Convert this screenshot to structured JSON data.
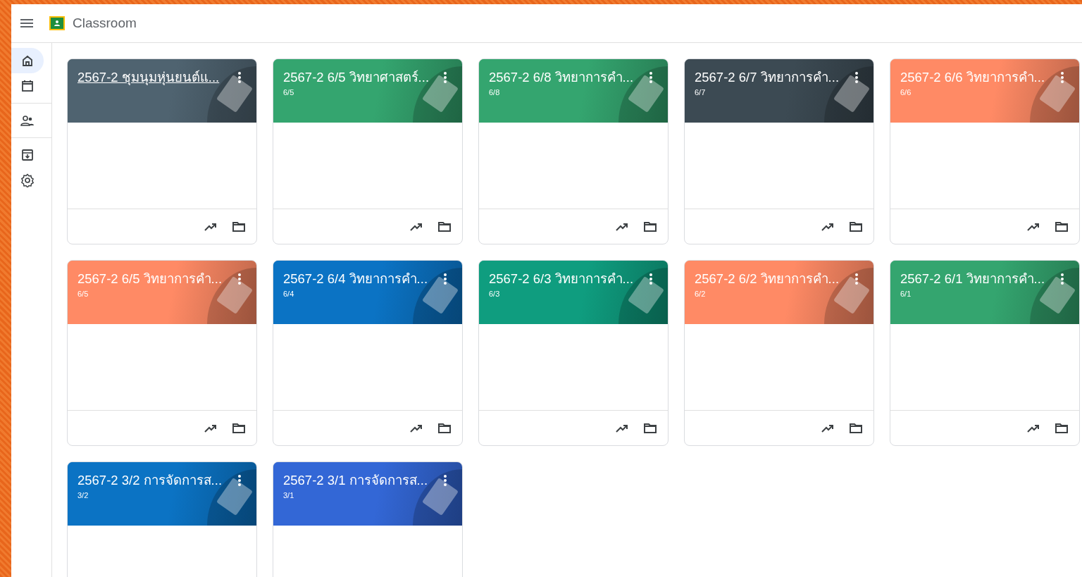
{
  "app": {
    "title": "Classroom"
  },
  "sidebar": {
    "items": [
      {
        "selected": true
      },
      {
        "selected": false
      },
      {
        "selected": false
      },
      {
        "selected": false
      },
      {
        "selected": false
      }
    ]
  },
  "classes": [
    {
      "title": "2567-2 ชุมนุมหุ่นยนต์แ...",
      "color": "#4f6370",
      "hovered": true
    },
    {
      "title": "2567-2 6/5 วิทยาศาสตร์...",
      "section": "6/5",
      "color": "#34a56f",
      "hovered": false
    },
    {
      "title": "2567-2 6/8 วิทยาการคำ...",
      "section": "6/8",
      "color": "#34a56f",
      "hovered": false
    },
    {
      "title": "2567-2 6/7 วิทยาการคำ...",
      "section": "6/7",
      "color": "#3c4a53",
      "hovered": false
    },
    {
      "title": "2567-2 6/6 วิทยาการคำ...",
      "section": "6/6",
      "color": "#ff8a65",
      "hovered": false
    },
    {
      "title": "2567-2 6/5 วิทยาการคำ...",
      "section": "6/5",
      "color": "#ff8a65",
      "hovered": false
    },
    {
      "title": "2567-2 6/4 วิทยาการคำ...",
      "section": "6/4",
      "color": "#0b73c4",
      "hovered": false
    },
    {
      "title": "2567-2 6/3 วิทยาการคำ...",
      "section": "6/3",
      "color": "#0f9d7f",
      "hovered": false
    },
    {
      "title": "2567-2 6/2 วิทยาการคำ...",
      "section": "6/2",
      "color": "#ff8a65",
      "hovered": false
    },
    {
      "title": "2567-2 6/1 วิทยาการคำ...",
      "section": "6/1",
      "color": "#34a56f",
      "hovered": false
    },
    {
      "title": "2567-2 3/2 การจัดการส...",
      "section": "3/2",
      "color": "#0b73c4",
      "hovered": false
    },
    {
      "title": "2567-2 3/1 การจัดการส...",
      "section": "3/1",
      "color": "#3367d6",
      "hovered": false
    }
  ]
}
